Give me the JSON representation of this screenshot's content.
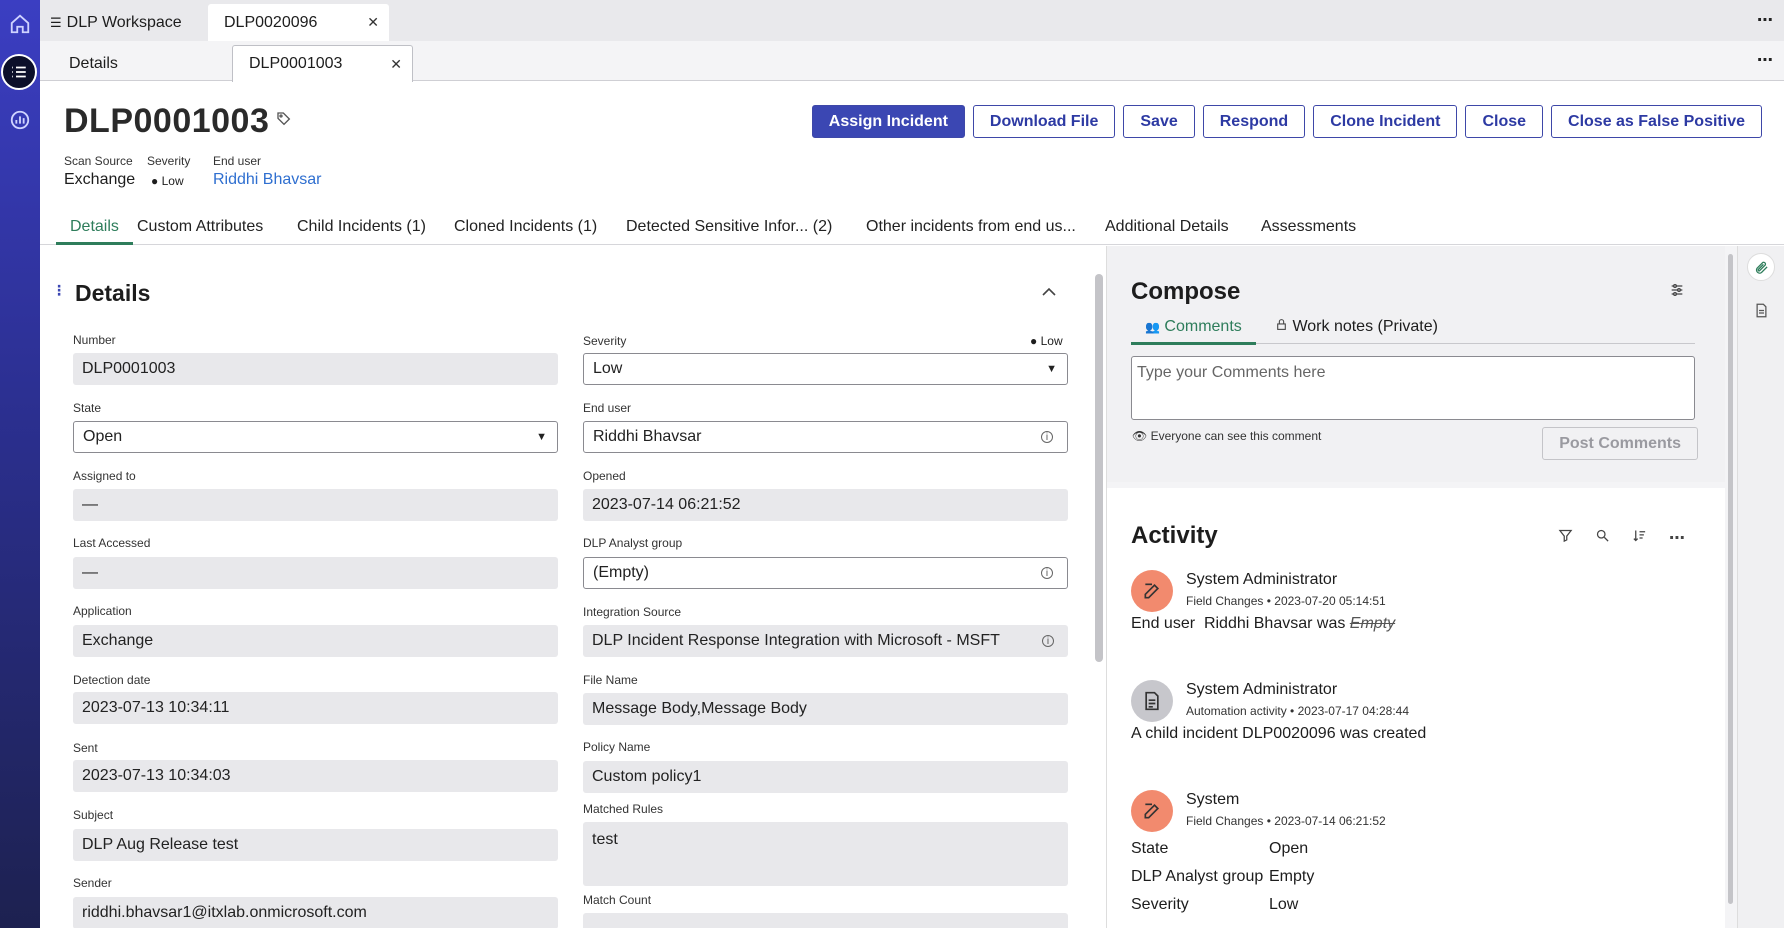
{
  "window": {
    "tabs": [
      "DLP Workspace",
      "DLP0020096"
    ],
    "subtabs": [
      "Details",
      "DLP0001003"
    ]
  },
  "record": {
    "title": "DLP0001003",
    "meta": {
      "scan_source_label": "Scan Source",
      "scan_source": "Exchange",
      "severity_label": "Severity",
      "severity": "Low",
      "end_user_label": "End user",
      "end_user": "Riddhi Bhavsar"
    }
  },
  "actions": [
    "Assign Incident",
    "Download File",
    "Save",
    "Respond",
    "Clone Incident",
    "Close",
    "Close as False Positive"
  ],
  "tabs": [
    "Details",
    "Custom Attributes",
    "Child Incidents (1)",
    "Cloned Incidents (1)",
    "Detected Sensitive Infor...  (2)",
    "Other incidents from end us...",
    "Additional Details",
    "Assessments"
  ],
  "details": {
    "title": "Details",
    "left": [
      {
        "label": "Number",
        "value": "DLP0001003"
      },
      {
        "label": "State",
        "value": "Open"
      },
      {
        "label": "Assigned to",
        "value": "—"
      },
      {
        "label": "Last Accessed",
        "value": "—"
      },
      {
        "label": "Application",
        "value": "Exchange"
      },
      {
        "label": "Detection date",
        "value": "2023-07-13 10:34:11"
      },
      {
        "label": "Sent",
        "value": "2023-07-13 10:34:03"
      },
      {
        "label": "Subject",
        "value": "DLP Aug Release test"
      },
      {
        "label": "Sender",
        "value": "riddhi.bhavsar1@itxlab.onmicrosoft.com"
      }
    ],
    "right": [
      {
        "label": "Severity",
        "value": "Low"
      },
      {
        "label": "End user",
        "value": "Riddhi Bhavsar"
      },
      {
        "label": "Opened",
        "value": "2023-07-14 06:21:52"
      },
      {
        "label": "DLP Analyst group",
        "value": "(Empty)"
      },
      {
        "label": "Integration Source",
        "value": "DLP Incident Response Integration with Microsoft - MSFT"
      },
      {
        "label": "File Name",
        "value": "Message Body,Message Body"
      },
      {
        "label": "Policy Name",
        "value": "Custom policy1"
      },
      {
        "label": "Matched Rules",
        "value": "test"
      },
      {
        "label": "Match Count",
        "value": ""
      }
    ],
    "severity_hint": "Low"
  },
  "compose": {
    "title": "Compose",
    "tab_comments": "Comments",
    "tab_worknotes": "Work notes (Private)",
    "placeholder": "Type your Comments here",
    "note": "Everyone can see this comment",
    "post": "Post Comments"
  },
  "activity": {
    "title": "Activity",
    "entries": [
      {
        "name": "System Administrator",
        "type": "Field Changes",
        "time": "2023-07-20 05:14:51",
        "field": "End user",
        "value": "Riddhi Bhavsar was",
        "old": "Empty"
      },
      {
        "name": "System Administrator",
        "type": "Automation activity",
        "time": "2023-07-17 04:28:44",
        "text": "A child incident DLP0020096 was created"
      },
      {
        "name": "System",
        "type": "Field Changes",
        "time": "2023-07-14 06:21:52",
        "changes": [
          {
            "field": "State",
            "value": "Open"
          },
          {
            "field": "DLP Analyst group",
            "value": "Empty"
          },
          {
            "field": "Severity",
            "value": "Low"
          }
        ]
      }
    ]
  }
}
